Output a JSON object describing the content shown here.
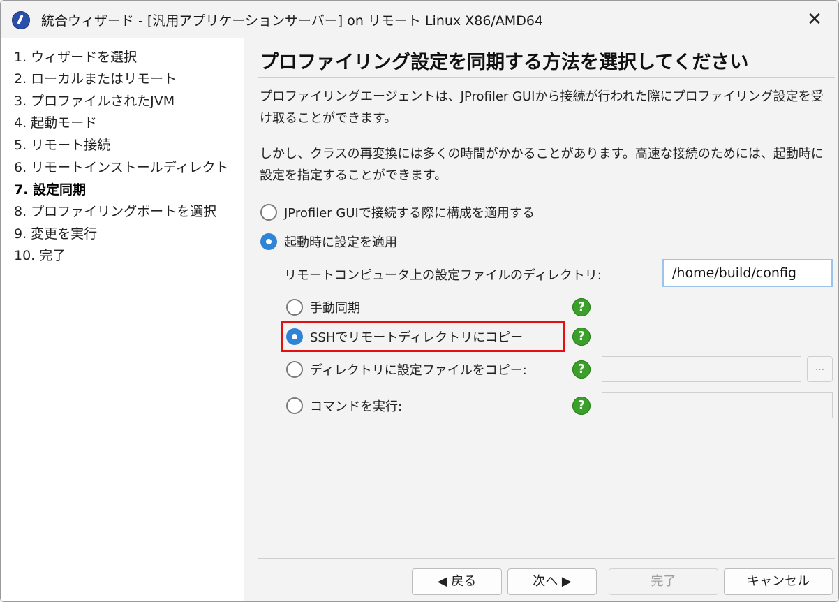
{
  "window": {
    "title": "統合ウィザード - [汎用アプリケーションサーバー] on リモート Linux X86/AMD64",
    "close_glyph": "✕"
  },
  "sidebar": {
    "steps": [
      {
        "label": "1. ウィザードを選択",
        "active": false
      },
      {
        "label": "2. ローカルまたはリモート",
        "active": false
      },
      {
        "label": "3. プロファイルされたJVM",
        "active": false
      },
      {
        "label": "4. 起動モード",
        "active": false
      },
      {
        "label": "5. リモート接続",
        "active": false
      },
      {
        "label": "6. リモートインストールディレクト",
        "active": false
      },
      {
        "label": "7. 設定同期",
        "active": true
      },
      {
        "label": "8. プロファイリングポートを選択",
        "active": false
      },
      {
        "label": "9. 変更を実行",
        "active": false
      },
      {
        "label": "10. 完了",
        "active": false
      }
    ]
  },
  "main": {
    "heading": "プロファイリング設定を同期する方法を選択してください",
    "paragraph1": "プロファイリングエージェントは、JProfiler GUIから接続が行われた際にプロファイリング設定を受け取ることができます。",
    "paragraph2": "しかし、クラスの再変換には多くの時間がかかることがあります。高速な接続のためには、起動時に設定を指定することができます。",
    "option_gui": {
      "label": "JProfiler GUIで接続する際に構成を適用する",
      "checked": false
    },
    "option_startup": {
      "label": "起動時に設定を適用",
      "checked": true
    },
    "config_dir_label": "リモートコンピュータ上の設定ファイルのディレクトリ:",
    "config_dir_value": "/home/build/config",
    "sync_options": [
      {
        "label": "手動同期",
        "checked": false
      },
      {
        "label": "SSHでリモートディレクトリにコピー",
        "checked": true
      },
      {
        "label": "ディレクトリに設定ファイルをコピー:",
        "checked": false
      },
      {
        "label": "コマンドを実行:",
        "checked": false
      }
    ],
    "help_glyph": "?",
    "browse_glyph": "...",
    "highlight_color": "#e41010",
    "accent_color": "#2f84d6"
  },
  "footer": {
    "back_label": "◀ 戻る",
    "next_label": "次へ ▶",
    "finish_label": "完了",
    "cancel_label": "キャンセル"
  }
}
